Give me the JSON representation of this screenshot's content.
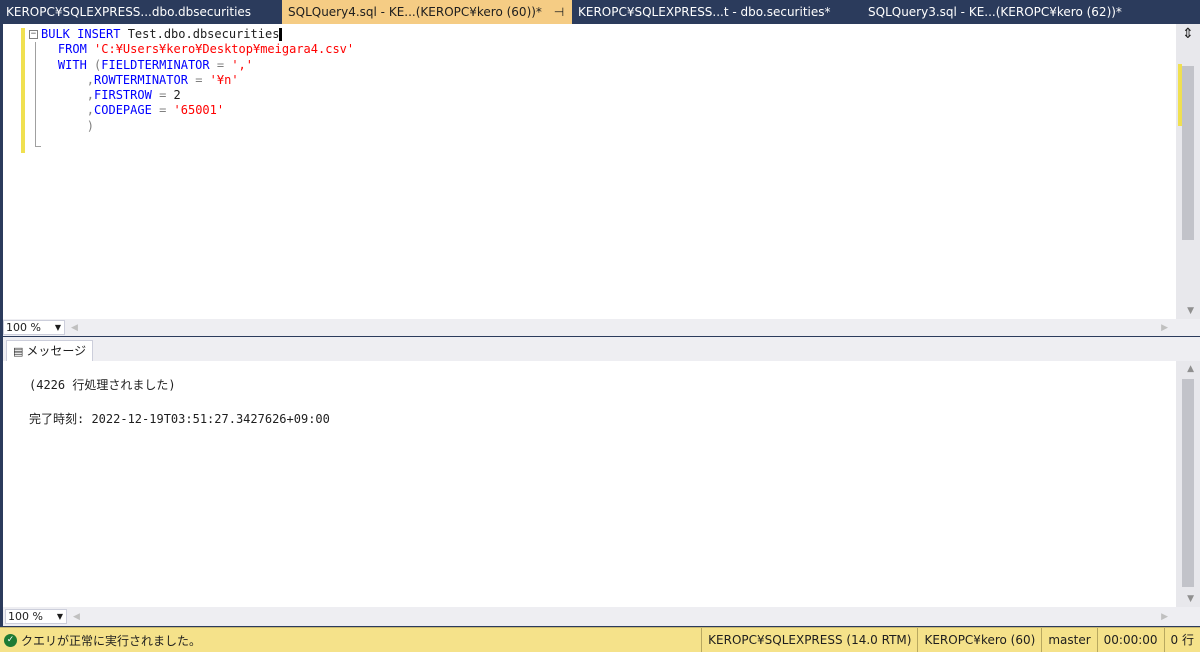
{
  "tabs": [
    {
      "label": "KEROPC¥SQLEXPRESS...dbo.dbsecurities",
      "active": false
    },
    {
      "label": "SQLQuery4.sql - KE...(KEROPC¥kero (60))*",
      "active": true,
      "pin": "⊣",
      "close": "✕"
    },
    {
      "label": "KEROPC¥SQLEXPRESS...t - dbo.securities*",
      "active": false
    },
    {
      "label": "SQLQuery3.sql - KE...(KEROPC¥kero (62))*",
      "active": false
    }
  ],
  "editor": {
    "lines": [
      {
        "kw1": "BULK INSERT ",
        "plain": "Test.dbo.dbsecurities"
      },
      {
        "kw1": "FROM ",
        "str": "'C:¥Users¥kero¥Desktop¥meigara4.csv'"
      },
      {
        "kw1": "WITH ",
        "punct": "(",
        "kw2": "FIELDTERMINATOR ",
        "punct2": "= ",
        "str": "','"
      },
      {
        "punct": ",",
        "kw1": "ROWTERMINATOR ",
        "punct2": "= ",
        "str": "'¥n'"
      },
      {
        "punct": ",",
        "kw1": "FIRSTROW ",
        "punct2": "= ",
        "plain": "2"
      },
      {
        "punct": ",",
        "kw1": "CODEPAGE ",
        "punct2": "= ",
        "str": "'65001'"
      },
      {
        "punct": ")"
      }
    ],
    "split_icon": "⇕"
  },
  "zoom": {
    "value": "100 %"
  },
  "results": {
    "tab_label": "メッセージ",
    "messages": [
      "(4226 行処理されました)",
      "完了時刻: 2022-12-19T03:51:27.3427626+09:00"
    ]
  },
  "zoom2": {
    "value": "100 %"
  },
  "status": {
    "message": "クエリが正常に実行されました。",
    "server": "KEROPC¥SQLEXPRESS (14.0 RTM)",
    "user": "KEROPC¥kero (60)",
    "database": "master",
    "elapsed": "00:00:00",
    "rows": "0 行"
  }
}
